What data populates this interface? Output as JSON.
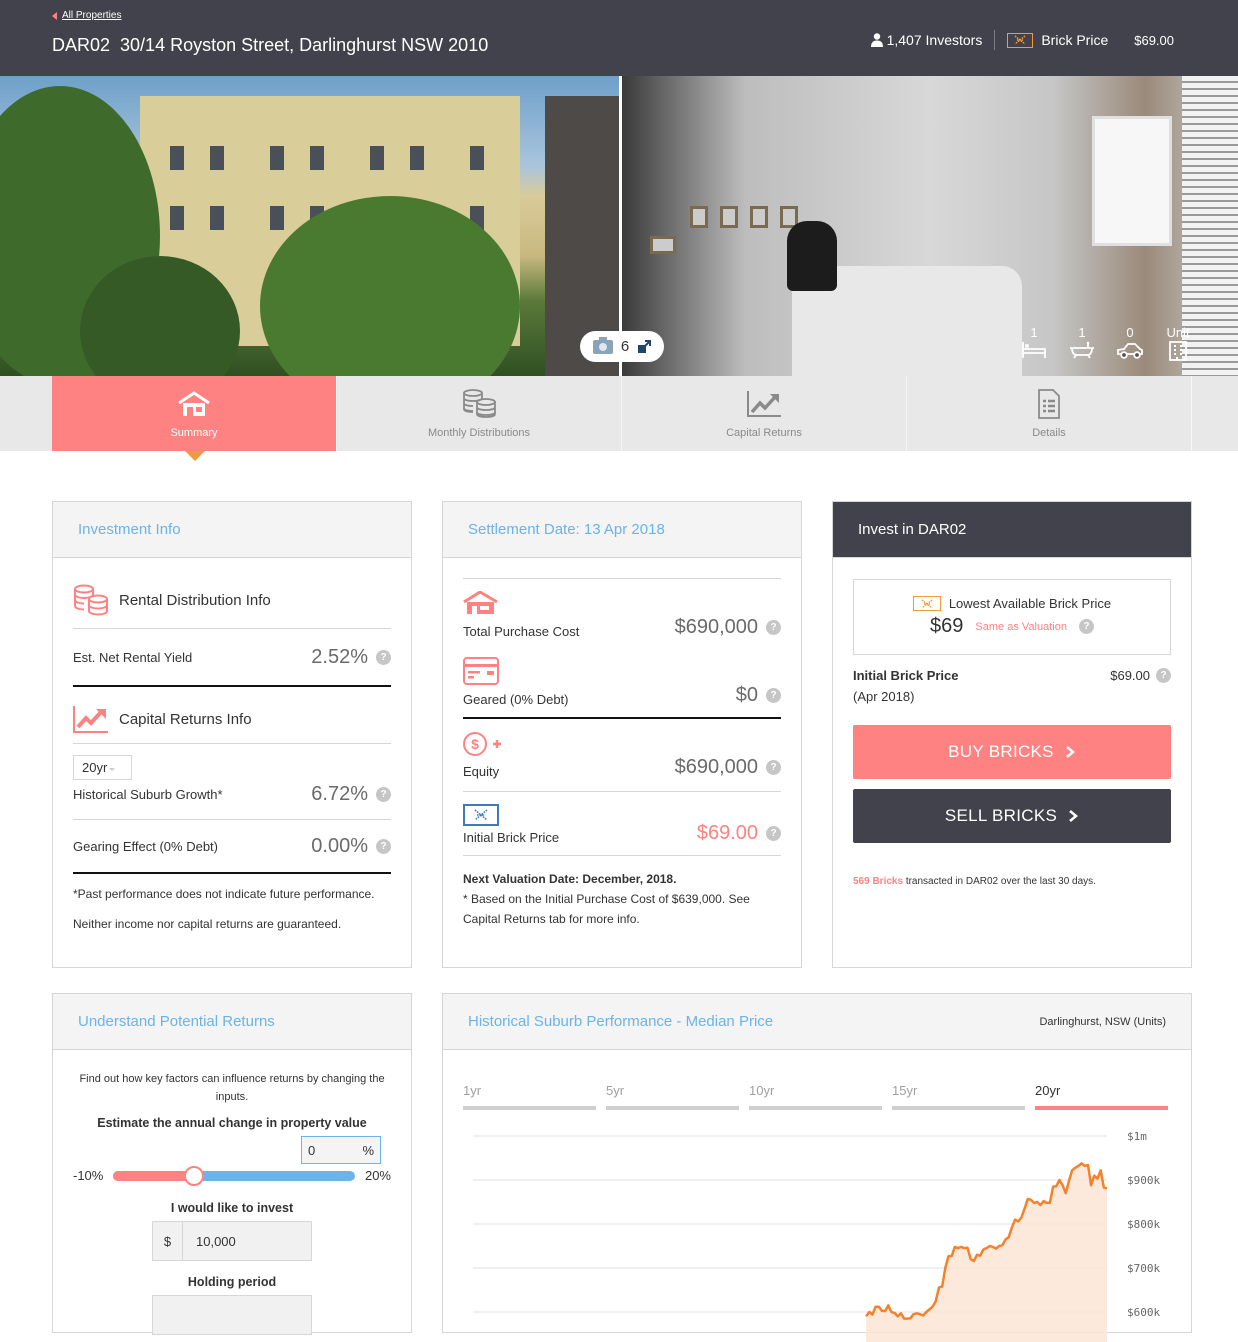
{
  "header": {
    "back_link": "All Properties",
    "property_code": "DAR02",
    "address": "30/14 Royston Street, Darlinghurst NSW 2010",
    "investors": "1,407 Investors",
    "brick_price_label": "Brick Price",
    "brick_price_value": "$69.00"
  },
  "gallery": {
    "photo_count": "6",
    "features": [
      {
        "value": "1",
        "icon": "bed-icon"
      },
      {
        "value": "1",
        "icon": "bath-icon"
      },
      {
        "value": "0",
        "icon": "car-icon"
      },
      {
        "value": "Unit",
        "icon": "building-icon"
      }
    ]
  },
  "tabs": [
    {
      "label": "Summary",
      "icon": "house-icon",
      "active": true
    },
    {
      "label": "Monthly Distributions",
      "icon": "coins-icon",
      "active": false
    },
    {
      "label": "Capital Returns",
      "icon": "chart-icon",
      "active": false
    },
    {
      "label": "Details",
      "icon": "document-icon",
      "active": false
    }
  ],
  "investment_info": {
    "title": "Investment Info",
    "rental_section": "Rental Distribution Info",
    "rental_yield_label": "Est. Net Rental Yield",
    "rental_yield_value": "2.52%",
    "capital_section": "Capital Returns Info",
    "period_select": "20yr",
    "growth_label": "Historical Suburb Growth*",
    "growth_value": "6.72%",
    "gearing_label": "Gearing Effect (0% Debt)",
    "gearing_value": "0.00%",
    "disclaimer1": "*Past performance does not indicate future performance.",
    "disclaimer2": "Neither income nor capital returns are guaranteed."
  },
  "settlement": {
    "title": "Settlement Date: 13 Apr 2018",
    "purchase_label": "Total Purchase Cost",
    "purchase_value": "$690,000",
    "geared_label": "Geared (0% Debt)",
    "geared_value": "$0",
    "equity_label": "Equity",
    "equity_value": "$690,000",
    "initial_label": "Initial Brick Price",
    "initial_value": "$69.00",
    "next_valuation": "Next Valuation Date: December, 2018.",
    "footnote": "* Based on the Initial Purchase Cost of $639,000. See Capital Returns tab for more info."
  },
  "invest": {
    "title": "Invest in DAR02",
    "lowest_label": "Lowest Available Brick Price",
    "lowest_value": "$69",
    "same_as": "Same as Valuation",
    "initial_label": "Initial Brick Price",
    "initial_date": "(Apr 2018)",
    "initial_value": "$69.00",
    "buy_label": "BUY BRICKS",
    "sell_label": "SELL BRICKS",
    "transacted_count": "569 Bricks",
    "transacted_text": "transacted in DAR02 over the last 30 days."
  },
  "potential": {
    "title": "Understand Potential Returns",
    "intro": "Find out how key factors can influence returns by changing the inputs.",
    "estimate_label": "Estimate the annual change in property value",
    "estimate_value": "0",
    "percent_sign": "%",
    "slider_min": "-10%",
    "slider_max": "20%",
    "slider_value": 0,
    "slider_range": [
      -10,
      20
    ],
    "invest_label": "I would like to invest",
    "currency": "$",
    "invest_value": "10,000",
    "holding_label": "Holding period"
  },
  "colors": {
    "accent": "#ff8282",
    "dark": "#42424c",
    "link": "#6bb3e8",
    "chart_line": "#f5822a"
  },
  "chart_data": {
    "type": "area",
    "title": "Historical Suburb Performance - Median Price",
    "subtitle": "Darlinghurst, NSW (Units)",
    "range_tabs": [
      "1yr",
      "5yr",
      "10yr",
      "15yr",
      "20yr"
    ],
    "active_range": "20yr",
    "y_tick_labels": [
      "$1m",
      "$900k",
      "$800k",
      "$700k",
      "$600k"
    ],
    "y_ticks": [
      1000000,
      900000,
      800000,
      700000,
      600000
    ],
    "ylim": [
      580000,
      1000000
    ],
    "grid": true,
    "x_fraction_start": 0.62,
    "series": [
      {
        "name": "Median Price",
        "values": [
          590000,
          600000,
          594000,
          612000,
          612000,
          603000,
          602000,
          615000,
          600000,
          598000,
          590000,
          597000,
          585000,
          585000,
          586000,
          595000,
          597000,
          595000,
          592000,
          600000,
          606000,
          612000,
          625000,
          656000,
          658000,
          700000,
          727000,
          727000,
          748000,
          745000,
          748000,
          745000,
          746000,
          720000,
          716000,
          730000,
          728000,
          742000,
          745000,
          750000,
          748000,
          744000,
          750000,
          752000,
          765000,
          770000,
          792000,
          810000,
          806000,
          815000,
          835000,
          857000,
          855000,
          848000,
          850000,
          843000,
          852000,
          848000,
          848000,
          885000,
          886000,
          900000,
          888000,
          870000,
          898000,
          922000,
          928000,
          932000,
          938000,
          932000,
          934000,
          888000,
          910000,
          903000,
          922000,
          883000,
          881000
        ]
      }
    ]
  }
}
